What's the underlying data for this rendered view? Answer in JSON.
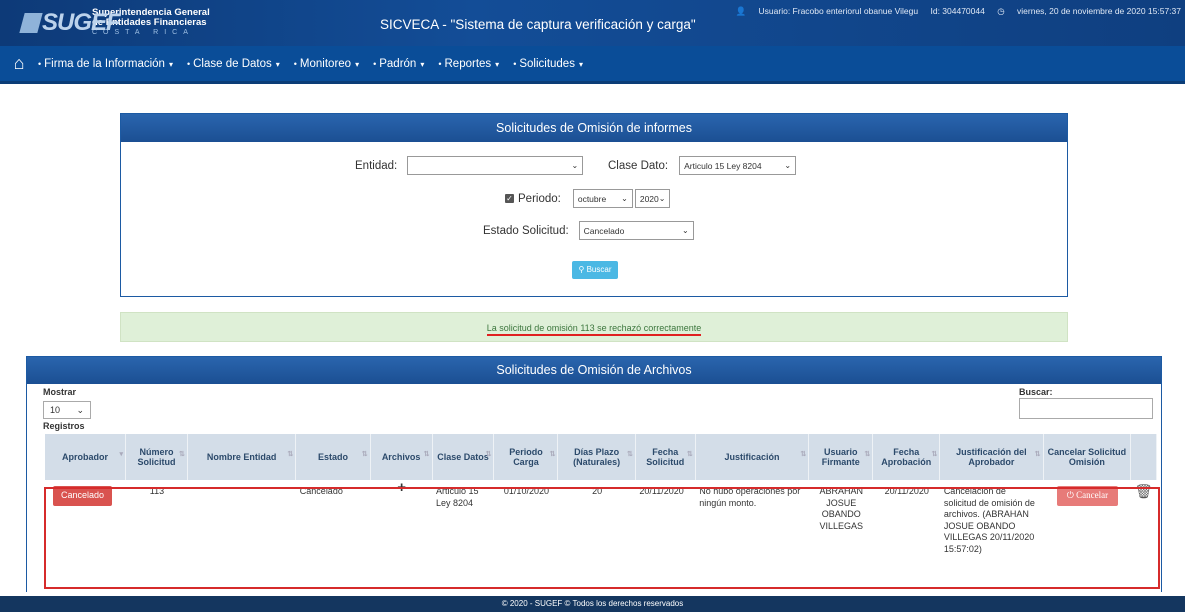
{
  "header": {
    "logo_word": "SUGEF",
    "logo_line1": "Superintendencia General",
    "logo_line2": "de Entidades Financieras",
    "logo_line3": "COSTA RICA",
    "app_title": "SICVECA - \"Sistema de captura verificación y carga\"",
    "user": "Usuario: Fracobo enteriorul obanue Vilegu",
    "user_id": "Id: 304470044",
    "datetime": "viernes, 20 de noviembre de 2020 15:57:37"
  },
  "nav": {
    "home_icon": "home-icon",
    "items": [
      {
        "label": "Firma de la Información"
      },
      {
        "label": "Clase de Datos"
      },
      {
        "label": "Monitoreo"
      },
      {
        "label": "Padrón"
      },
      {
        "label": "Reportes"
      },
      {
        "label": "Solicitudes"
      }
    ]
  },
  "filter_panel": {
    "title": "Solicitudes de Omisión de informes",
    "entidad_label": "Entidad:",
    "entidad_value": "",
    "clase_dato_label": "Clase Dato:",
    "clase_dato_value": "Articulo 15 Ley 8204",
    "periodo_label": "Periodo:",
    "periodo_checked": true,
    "periodo_month": "octubre",
    "periodo_year": "2020",
    "estado_label": "Estado Solicitud:",
    "estado_value": "Cancelado",
    "search_button": "Buscar"
  },
  "alert": {
    "message": "La solicitud de omisión 113 se rechazó correctamente",
    "color": "#dff0d8"
  },
  "files_panel": {
    "title": "Solicitudes de Omisión de Archivos",
    "mostrar_label": "Mostrar",
    "mostrar_value": "10",
    "registros_label": "Registros",
    "buscar_label": "Buscar:",
    "buscar_value": "",
    "columns": [
      "Aprobador",
      "Número Solicitud",
      "Nombre Entidad",
      "Estado",
      "Archivos",
      "Clase Datos",
      "Periodo Carga",
      "Días Plazo (Naturales)",
      "Fecha Solicitud",
      "Justificación",
      "Usuario Firmante",
      "Fecha Aprobación",
      "Justificación del Aprobador",
      "Cancelar Solicitud Omisión"
    ],
    "rows": [
      {
        "aprobador": "Cancelado",
        "numero": "113",
        "nombre_entidad": "",
        "estado": "Cancelado",
        "archivos": "+",
        "clase_datos": "Articulo 15 Ley 8204",
        "periodo_carga": "01/10/2020",
        "dias_plazo": "20",
        "fecha_solicitud": "20/11/2020",
        "justificacion": "No hubo operaciones por ningún monto.",
        "usuario_firmante": "ABRAHAN JOSUE OBANDO VILLEGAS",
        "fecha_aprobacion": "20/11/2020",
        "justificacion_aprobador": "Cancelación de solicitud de omisión de archivos. (ABRAHAN JOSUE OBANDO VILLEGAS 20/11/2020 15:57:02)",
        "cancelar_label": "Cancelar"
      }
    ]
  },
  "footer": {
    "text": "© 2020 - SUGEF © Todos los derechos reservados"
  },
  "colors": {
    "header_blue": "#0a4d98",
    "panel_head": "#1b4f93",
    "danger": "#d9534f",
    "info": "#4bb8e4"
  }
}
